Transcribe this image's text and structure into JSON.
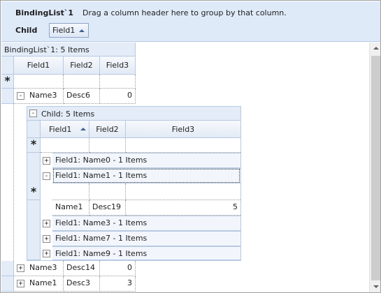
{
  "groupby": {
    "title": "BindingList`1",
    "hint": "Drag a column header here to group by that column.",
    "child_label": "Child",
    "child_chip": "Field1"
  },
  "band": {
    "caption": "BindingList`1: 5 Items",
    "columns": [
      "Field1",
      "Field2",
      "Field3"
    ],
    "new_row_symbol": "*"
  },
  "rows": [
    {
      "field1": "Name3",
      "field2": "Desc6",
      "field3": "0",
      "expander": "-"
    },
    {
      "field1": "Name3",
      "field2": "Desc14",
      "field3": "0",
      "expander": "+"
    },
    {
      "field1": "Name1",
      "field2": "Desc3",
      "field3": "3",
      "expander": "+"
    }
  ],
  "child": {
    "caption": "Child: 5 Items",
    "columns": [
      "Field1",
      "Field2",
      "Field3"
    ],
    "new_row_symbol": "*",
    "groups": [
      {
        "label": "Field1: Name0 - 1 Items",
        "expander": "+"
      },
      {
        "label": "Field1: Name1 - 1 Items",
        "expander": "-"
      },
      {
        "label": "Field1: Name3 - 1 Items",
        "expander": "+"
      },
      {
        "label": "Field1: Name7 - 1 Items",
        "expander": "+"
      },
      {
        "label": "Field1: Name9 - 1 Items",
        "expander": "+"
      }
    ],
    "group_new_row_symbol": "*",
    "group_row": {
      "field1": "Name1",
      "field2": "Desc19",
      "field3": "5"
    }
  }
}
